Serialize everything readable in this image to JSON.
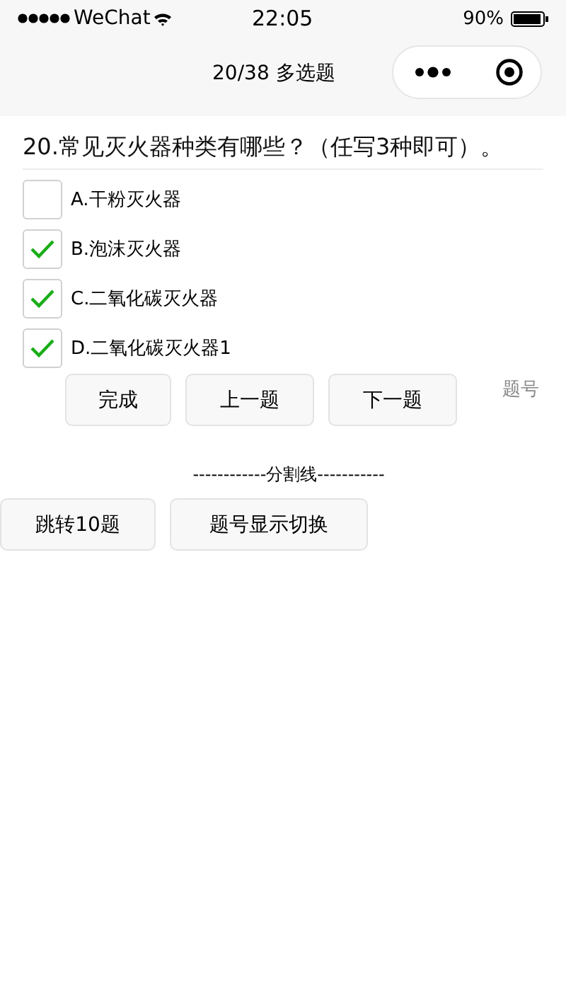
{
  "status_bar": {
    "carrier": "WeChat",
    "time": "22:05",
    "battery": "90%"
  },
  "nav": {
    "title": "20/38 多选题"
  },
  "question": {
    "text": "20.常见灭火器种类有哪些？（任写3种即可）。"
  },
  "options": [
    {
      "label": "A.干粉灭火器",
      "checked": false
    },
    {
      "label": "B.泡沫灭火器",
      "checked": true
    },
    {
      "label": "C.二氧化碳灭火器",
      "checked": true
    },
    {
      "label": "D.二氧化碳灭火器1",
      "checked": true
    }
  ],
  "actions": [
    "完成",
    "上一题",
    "下一题"
  ],
  "side_label": "题号",
  "divider": "------------分割线-----------",
  "extra_buttons": [
    "跳转10题",
    "题号显示切换"
  ]
}
